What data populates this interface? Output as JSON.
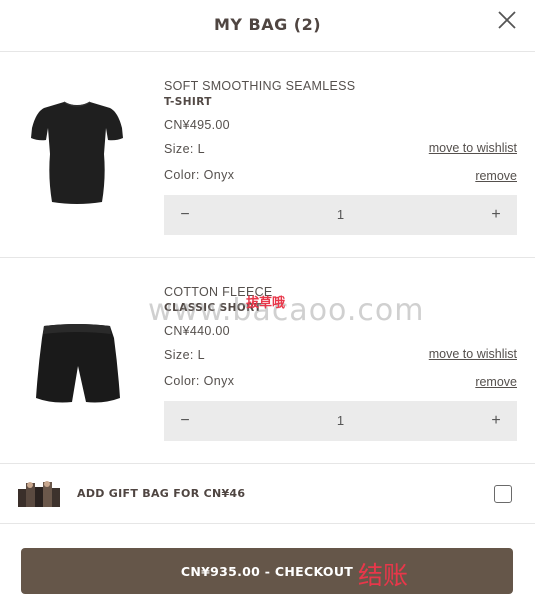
{
  "header": {
    "title": "MY BAG (2)",
    "close_icon": "close-icon"
  },
  "items": [
    {
      "name": "SOFT SMOOTHING SEAMLESS",
      "subname": "T-SHIRT",
      "price": "CN¥495.00",
      "size": "Size: L",
      "color": "Color: Onyx",
      "wishlist_label": "move to wishlist",
      "remove_label": "remove",
      "quantity": "1",
      "minus_label": "−",
      "plus_label": "+",
      "image_icon": "tshirt-image"
    },
    {
      "name": "COTTON FLEECE",
      "subname": "CLASSIC SHORT",
      "price": "CN¥440.00",
      "size": "Size: L",
      "color": "Color: Onyx",
      "wishlist_label": "move to wishlist",
      "remove_label": "remove",
      "quantity": "1",
      "minus_label": "−",
      "plus_label": "+",
      "image_icon": "shorts-image"
    }
  ],
  "gift": {
    "label": "ADD GIFT BAG FOR CN¥46",
    "checked": false,
    "image_icon": "gift-bag-image"
  },
  "checkout": {
    "label": "CN¥935.00 - CHECKOUT",
    "annotation": "结账"
  },
  "watermark": {
    "text": "www.bacaoo.com",
    "annotation": "拔草哦"
  },
  "colors": {
    "checkout_bg": "#655649",
    "text": "#55504d",
    "qty_bg": "#ebebeb",
    "annotation_red": "#e8374a"
  }
}
